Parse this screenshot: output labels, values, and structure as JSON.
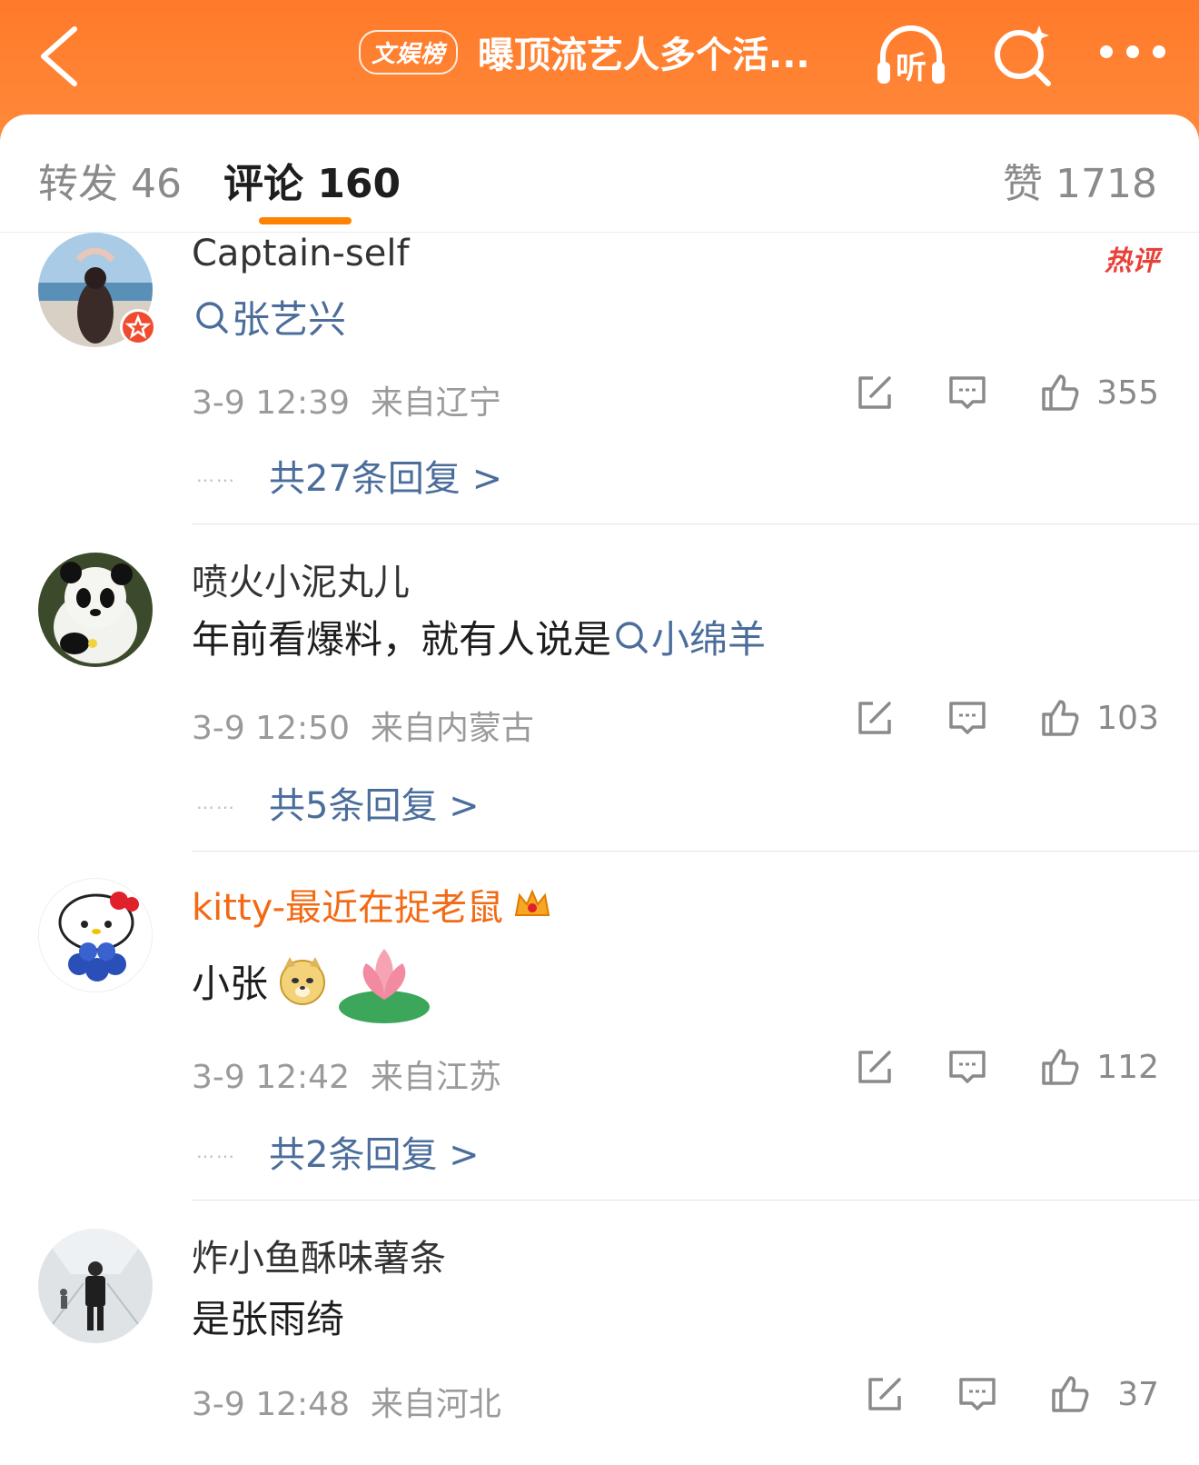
{
  "header": {
    "title_tag": "文娱榜",
    "title": "曝顶流艺人多个活...",
    "listen_label": "听",
    "accent_color": "#ff7a2a"
  },
  "tabs": {
    "repost": "转发 46",
    "comment": "评论 160",
    "like": "赞 1718",
    "active": "comment"
  },
  "comments": [
    {
      "name": "Captain-self",
      "hot_label": "热评",
      "content_topic": "张艺兴",
      "time": "3-9 12:39",
      "location": "来自辽宁",
      "likes": "355",
      "replies": "共27条回复 >"
    },
    {
      "name": "喷火小泥丸儿",
      "content_text": "年前看爆料，就有人说是",
      "content_topic": "小绵羊",
      "time": "3-9 12:50",
      "location": "来自内蒙古",
      "likes": "103",
      "replies": "共5条回复 >"
    },
    {
      "name": "kitty-最近在捉老鼠",
      "content_text": "小张",
      "time": "3-9 12:42",
      "location": "来自江苏",
      "likes": "112",
      "replies": "共2条回复 >"
    },
    {
      "name": "炸小鱼酥味薯条",
      "content_text": "是张雨绮",
      "time": "3-9 12:48",
      "location": "来自河北",
      "likes": "37"
    }
  ],
  "icons": {
    "back": "chevron-left-icon",
    "listen": "headphones-icon",
    "search": "search-sparkle-icon",
    "more": "more-dots-icon",
    "repost": "share-icon",
    "reply": "comment-icon",
    "like": "thumbs-up-icon"
  }
}
